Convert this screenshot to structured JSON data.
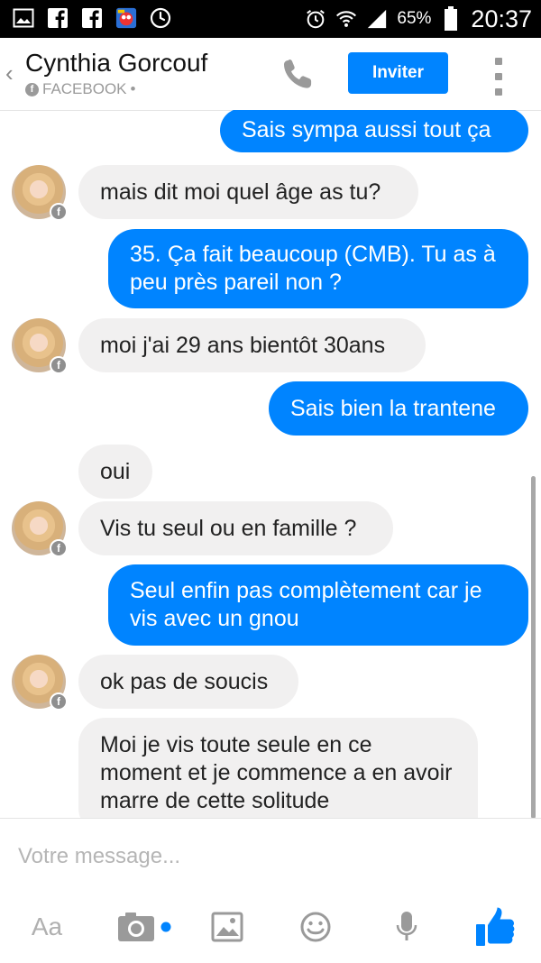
{
  "status_bar": {
    "battery_percent": "65%",
    "time": "20:37"
  },
  "header": {
    "back_glyph": "‹",
    "contact_name": "Cynthia Gorcouf",
    "source_label": "FACEBOOK",
    "source_suffix": "•",
    "invite_label": "Inviter"
  },
  "messages": [
    {
      "dir": "out",
      "text": "Sais sympa aussi tout ça"
    },
    {
      "dir": "in",
      "text": "mais dit moi quel âge as tu?"
    },
    {
      "dir": "out",
      "text": "35. Ça fait beaucoup (CMB). Tu as à peu près pareil non ?"
    },
    {
      "dir": "in",
      "text": "moi j'ai 29 ans bientôt 30ans"
    },
    {
      "dir": "out",
      "text": "Sais bien la trantene"
    },
    {
      "dir": "in",
      "text": "oui"
    },
    {
      "dir": "in",
      "text": "Vis tu seul ou en famille ?"
    },
    {
      "dir": "out",
      "text": "Seul enfin pas complètement car je vis avec un gnou"
    },
    {
      "dir": "in",
      "text": "ok pas de soucis"
    },
    {
      "dir": "in",
      "text": "Moi je vis toute seule en ce moment et je commence a en avoir marre de cette solitude"
    }
  ],
  "composer": {
    "placeholder": "Votre message...",
    "text_tool_label": "Aa"
  },
  "icons": {
    "status": [
      "gallery-icon",
      "facebook-icon",
      "facebook-icon",
      "app-icon",
      "clock-icon",
      "alarm-icon",
      "wifi-icon",
      "signal-icon",
      "battery-icon"
    ],
    "header": [
      "back-icon",
      "facebook-icon",
      "phone-icon",
      "menu-icon"
    ],
    "composer": [
      "camera-icon",
      "image-icon",
      "emoji-icon",
      "microphone-icon",
      "like-icon"
    ]
  },
  "colors": {
    "accent": "#0084ff",
    "incoming_bubble": "#f1f0f0",
    "status_bar": "#000000"
  }
}
